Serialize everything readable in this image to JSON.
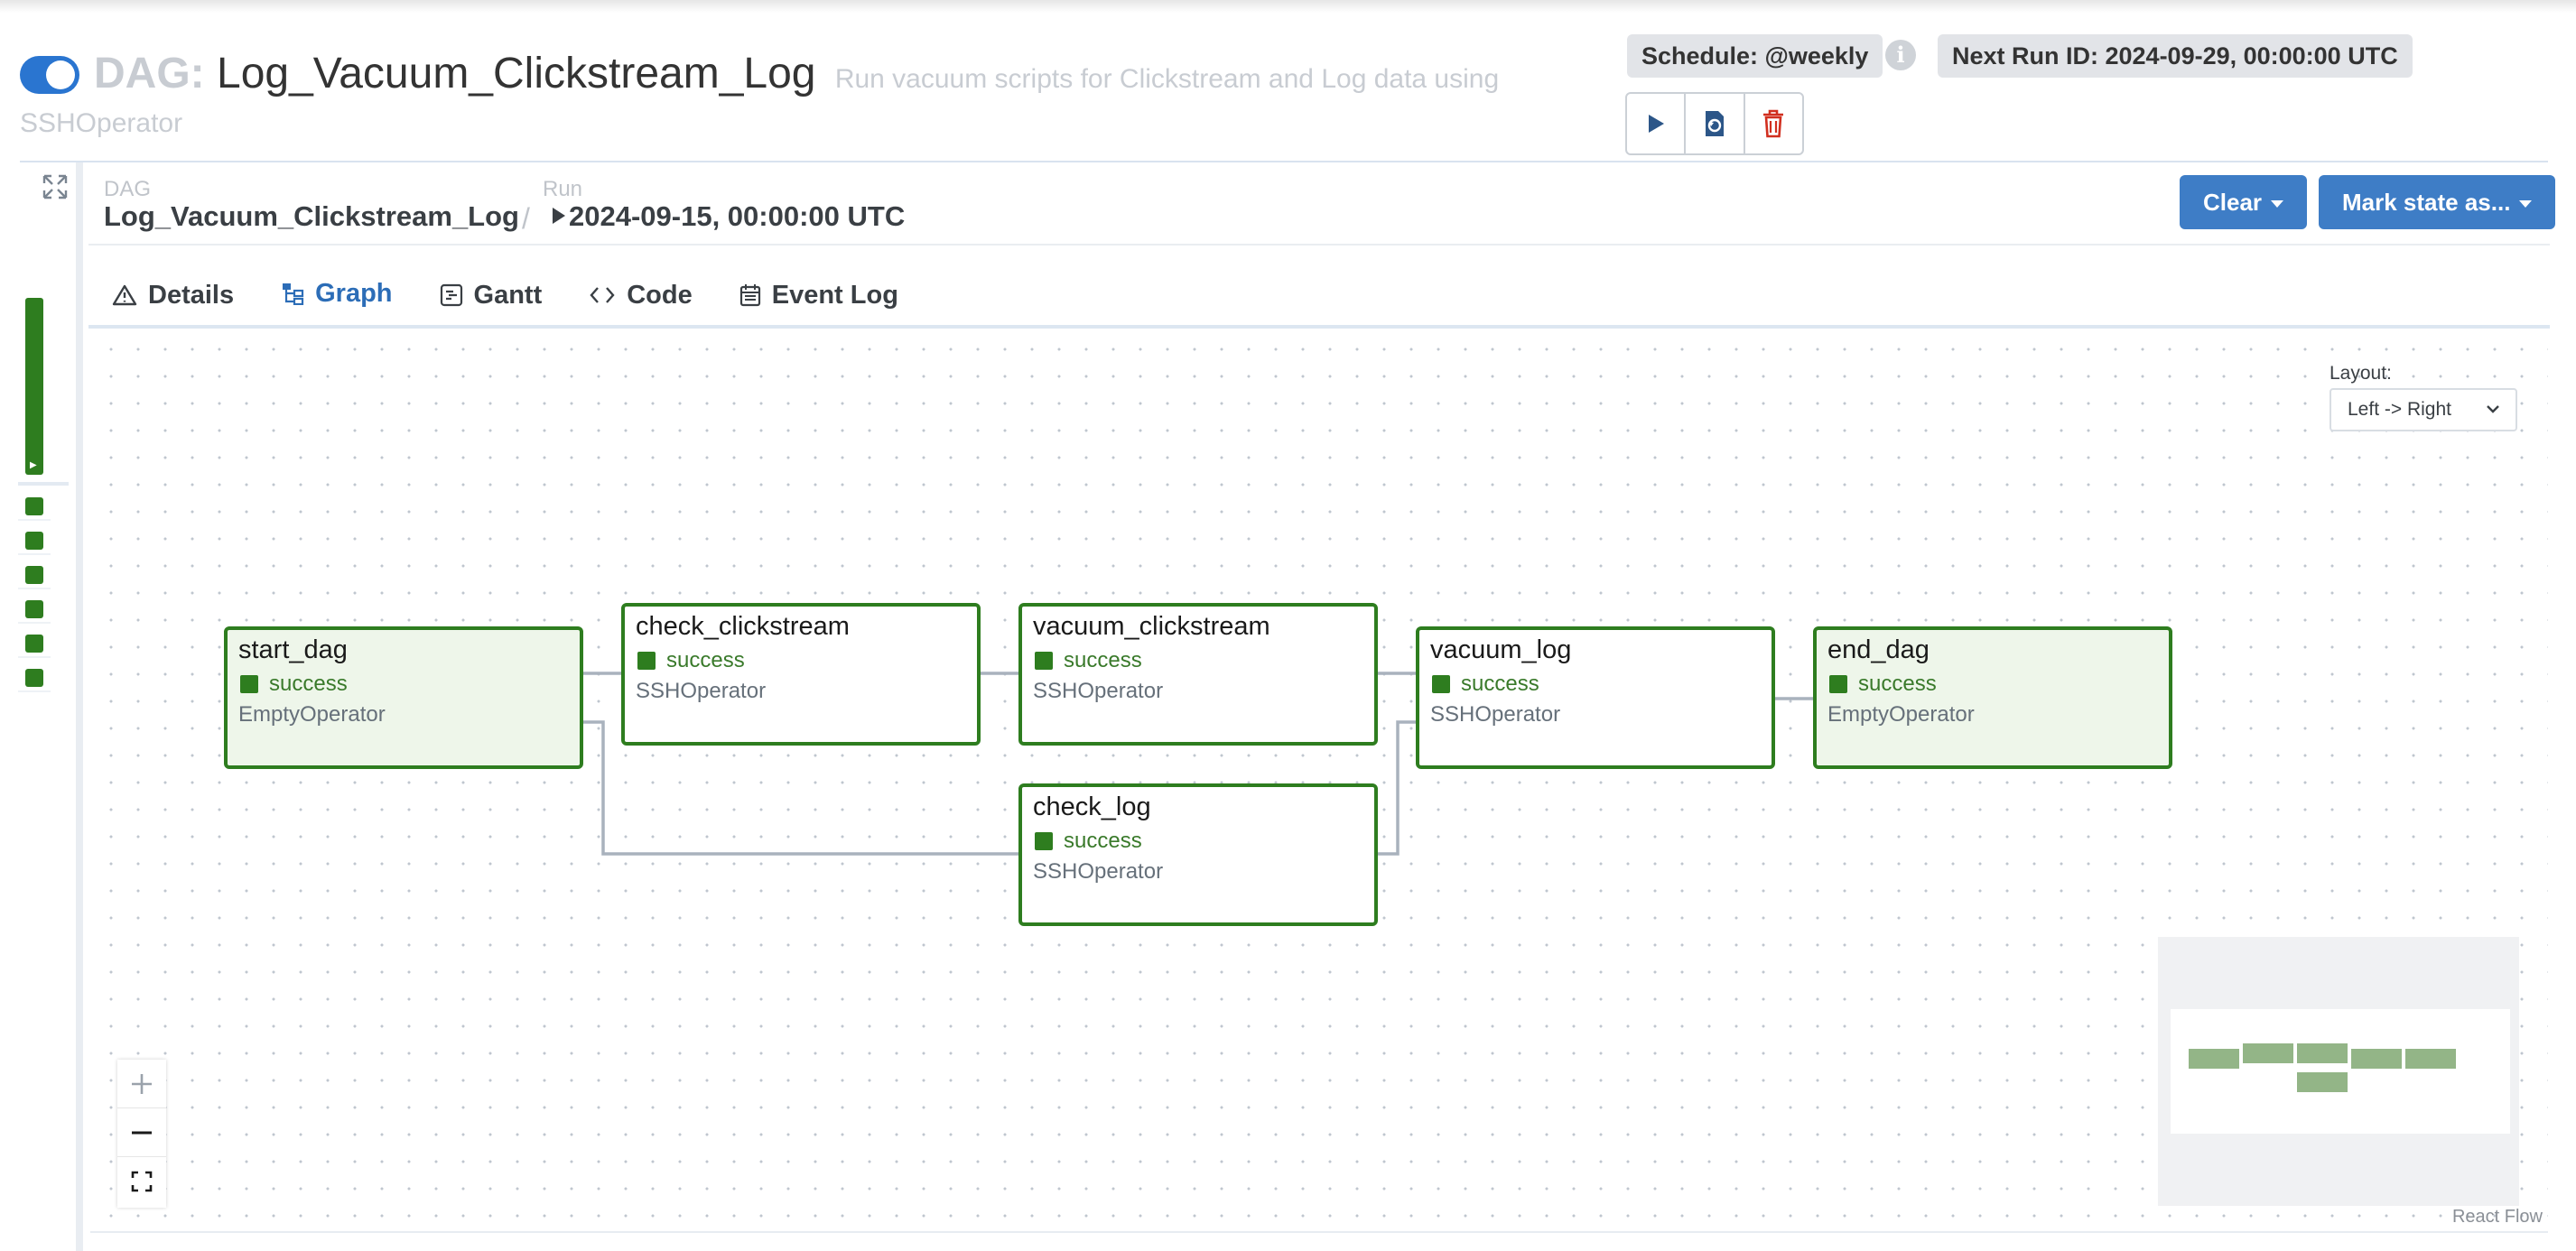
{
  "header": {
    "dag_prefix": "DAG:",
    "dag_id": "Log_Vacuum_Clickstream_Log",
    "description_line1": "Run vacuum scripts for Clickstream and Log data using",
    "description_line2": "SSHOperator",
    "schedule": "Schedule: @weekly",
    "next_run": "Next Run ID: 2024-09-29, 00:00:00 UTC",
    "info_glyph": "i",
    "toggle_on": true,
    "accent_color": "#2a75d0",
    "actions": [
      "play-icon",
      "reparse-icon",
      "trash-icon"
    ]
  },
  "breadcrumb": {
    "dag_label": "DAG",
    "dag_value": "Log_Vacuum_Clickstream_Log",
    "separator": "/",
    "run_label": "Run",
    "run_value": "2024-09-15, 00:00:00 UTC"
  },
  "buttons": {
    "clear": "Clear",
    "mark_state": "Mark state as..."
  },
  "tabs": [
    {
      "label": "Details",
      "icon": "warning-triangle-icon"
    },
    {
      "label": "Graph",
      "icon": "graph-icon",
      "active": true
    },
    {
      "label": "Gantt",
      "icon": "gantt-icon"
    },
    {
      "label": "Code",
      "icon": "code-icon"
    },
    {
      "label": "Event Log",
      "icon": "calendar-icon"
    }
  ],
  "layout": {
    "label": "Layout:",
    "value": "Left -> Right"
  },
  "nodes": {
    "start_dag": {
      "name": "start_dag",
      "state": "success",
      "operator": "EmptyOperator"
    },
    "check_clickstream": {
      "name": "check_clickstream",
      "state": "success",
      "operator": "SSHOperator"
    },
    "vacuum_clickstream": {
      "name": "vacuum_clickstream",
      "state": "success",
      "operator": "SSHOperator"
    },
    "check_log": {
      "name": "check_log",
      "state": "success",
      "operator": "SSHOperator"
    },
    "vacuum_log": {
      "name": "vacuum_log",
      "state": "success",
      "operator": "SSHOperator"
    },
    "end_dag": {
      "name": "end_dag",
      "state": "success",
      "operator": "EmptyOperator"
    }
  },
  "edges": [
    [
      "start_dag",
      "check_clickstream"
    ],
    [
      "start_dag",
      "check_log"
    ],
    [
      "check_clickstream",
      "vacuum_clickstream"
    ],
    [
      "vacuum_clickstream",
      "vacuum_log"
    ],
    [
      "check_log",
      "vacuum_log"
    ],
    [
      "vacuum_log",
      "end_dag"
    ]
  ],
  "status_colors": {
    "success": "#2e7d1f"
  },
  "attribution": "React Flow"
}
